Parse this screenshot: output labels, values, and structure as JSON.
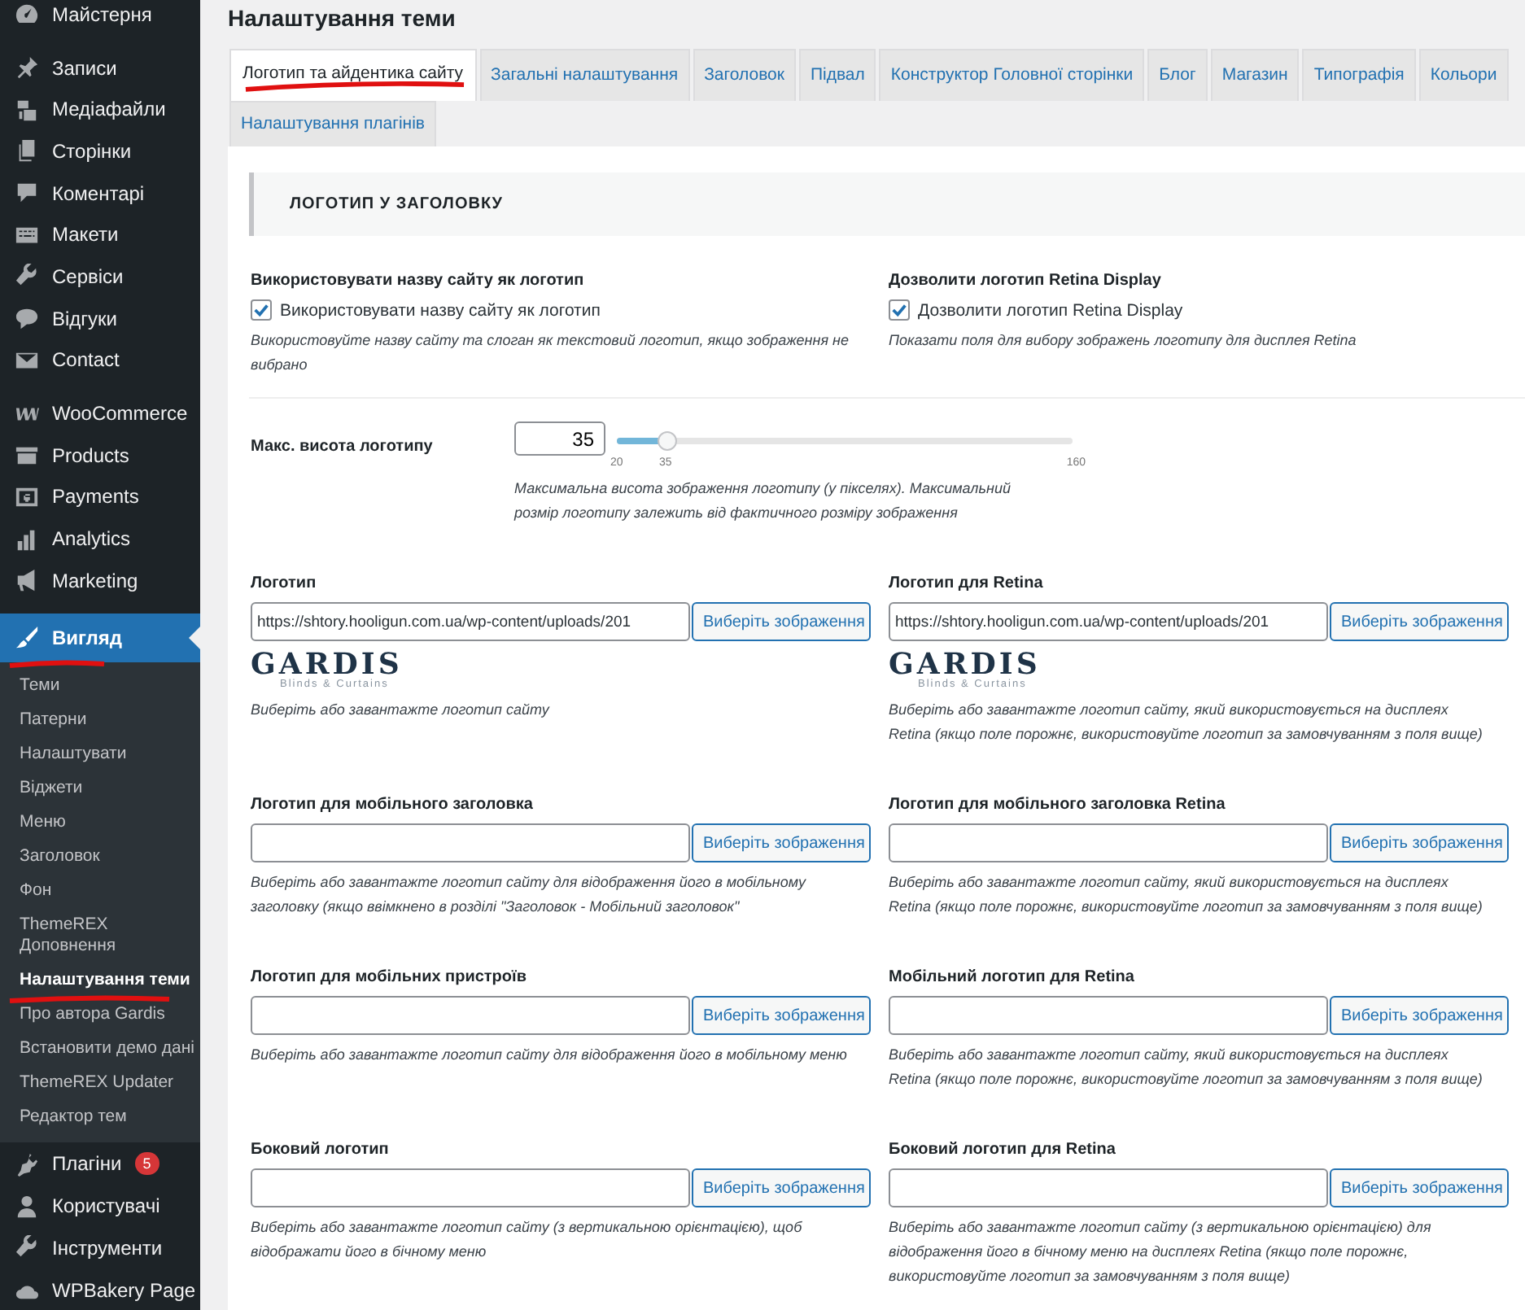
{
  "sidebar": {
    "groups": [
      {
        "items": [
          {
            "label": "Майстерня",
            "selected": false
          }
        ]
      },
      {
        "items": [
          {
            "label": "Записи",
            "selected": false
          },
          {
            "label": "Медіафайли",
            "selected": false
          },
          {
            "label": "Сторінки",
            "selected": false
          },
          {
            "label": "Коментарі",
            "selected": false
          },
          {
            "label": "Макети",
            "selected": false
          },
          {
            "label": "Сервіси",
            "selected": false
          },
          {
            "label": "Відгуки",
            "selected": false
          },
          {
            "label": "Contact",
            "selected": false
          }
        ]
      },
      {
        "items": [
          {
            "label": "WooCommerce",
            "selected": false
          },
          {
            "label": "Products",
            "selected": false
          },
          {
            "label": "Payments",
            "selected": false
          },
          {
            "label": "Analytics",
            "selected": false
          },
          {
            "label": "Marketing",
            "selected": false
          }
        ]
      },
      {
        "items": [
          {
            "label": "Вигляд",
            "selected": true,
            "expanded": true,
            "children": [
              {
                "label": "Теми",
                "selected": false
              },
              {
                "label": "Патерни",
                "selected": false
              },
              {
                "label": "Налаштувати",
                "selected": false
              },
              {
                "label": "Віджети",
                "selected": false
              },
              {
                "label": "Меню",
                "selected": false
              },
              {
                "label": "Заголовок",
                "selected": false
              },
              {
                "label": "Фон",
                "selected": false
              },
              {
                "label": "ThemeREX Доповнення",
                "selected": false
              },
              {
                "label": "Налаштування теми",
                "selected": true
              },
              {
                "label": "Про автора Gardis",
                "selected": false
              },
              {
                "label": "Встановити демо дані",
                "selected": false
              },
              {
                "label": "ThemeREX Updater",
                "selected": false
              },
              {
                "label": "Редактор тем",
                "selected": false
              }
            ]
          },
          {
            "label": "Плагіни",
            "selected": false,
            "badge": "5"
          },
          {
            "label": "Користувачі",
            "selected": false
          },
          {
            "label": "Інструменти",
            "selected": false
          },
          {
            "label": "WPBakery Page",
            "selected": false
          }
        ]
      }
    ]
  },
  "page_title": "Налаштування теми",
  "tabs": [
    {
      "label": "Логотип та айдентика сайту",
      "selected": true
    },
    {
      "label": "Загальні налаштування",
      "selected": false
    },
    {
      "label": "Заголовок",
      "selected": false
    },
    {
      "label": "Підвал",
      "selected": false
    },
    {
      "label": "Конструктор Головної сторінки",
      "selected": false
    },
    {
      "label": "Блог",
      "selected": false
    },
    {
      "label": "Магазин",
      "selected": false
    },
    {
      "label": "Типографія",
      "selected": false
    },
    {
      "label": "Кольори",
      "selected": false
    },
    {
      "label": "Налаштування плагінів",
      "selected": false
    }
  ],
  "section_heading": "ЛОГОТИП У ЗАГОЛОВКУ",
  "rows": [
    {
      "kind": "pair",
      "fields": [
        {
          "kind": "checkbox",
          "title": "Використовувати назву сайту як логотип",
          "checkbox_label": "Використовувати назву сайту як логотип",
          "checked": true,
          "description": "Використовуйте назву сайту та слоган як текстовий логотип, якщо зображення не вибрано"
        },
        {
          "kind": "checkbox",
          "title": "Дозволити логотип Retina Display",
          "checkbox_label": "Дозволити логотип Retina Display",
          "checked": true,
          "description": "Показати поля для вибору зображень логотипу для дисплея Retina"
        }
      ]
    },
    {
      "kind": "divider"
    },
    {
      "kind": "slider",
      "title": "Макс. висота логотипу",
      "value": "35",
      "level": 0.107,
      "min_label": "20",
      "thumb_label": "35",
      "max_label": "160",
      "description": "Максимальна висота зображення логотипу (у пікселях). Максимальний розмір логотипу залежить від фактичного розміру зображення"
    },
    {
      "kind": "pair",
      "fields": [
        {
          "kind": "image",
          "title": "Логотип",
          "value": "https://shtory.hooligun.com.ua/wp-content/uploads/201",
          "button": "Виберіть зображення",
          "preview": {
            "name": "GARDIS",
            "tagline": "Blinds & Curtains"
          },
          "description": "Виберіть або завантажте логотип сайту"
        },
        {
          "kind": "image",
          "title": "Логотип для Retina",
          "value": "https://shtory.hooligun.com.ua/wp-content/uploads/201",
          "button": "Виберіть зображення",
          "preview": {
            "name": "GARDIS",
            "tagline": "Blinds & Curtains"
          },
          "description": "Виберіть або завантажте логотип сайту, який використовується на дисплеях Retina (якщо поле порожнє, використовуйте логотип за замовчуванням з поля вище)"
        }
      ]
    },
    {
      "kind": "pair",
      "fields": [
        {
          "kind": "image",
          "title": "Логотип для мобільного заголовка",
          "button": "Виберіть зображення",
          "description": "Виберіть або завантажте логотип сайту для відображення його в мобільному заголовку (якщо ввімкнено в розділі \"Заголовок - Мобільний заголовок\""
        },
        {
          "kind": "image",
          "title": "Логотип для мобільного заголовка Retina",
          "button": "Виберіть зображення",
          "description": "Виберіть або завантажте логотип сайту, який використовується на дисплеях Retina (якщо поле порожнє, використовуйте логотип за замовчуванням з поля вище)"
        }
      ]
    },
    {
      "kind": "pair",
      "fields": [
        {
          "kind": "image",
          "title": "Логотип для мобільних пристроїв",
          "button": "Виберіть зображення",
          "description": "Виберіть або завантажте логотип сайту для відображення його в мобільному меню"
        },
        {
          "kind": "image",
          "title": "Мобільний логотип для Retina",
          "button": "Виберіть зображення",
          "description": "Виберіть або завантажте логотип сайту, який використовується на дисплеях Retina (якщо поле порожнє, використовуйте логотип за замовчуванням з поля вище)"
        }
      ]
    },
    {
      "kind": "pair",
      "fields": [
        {
          "kind": "image",
          "title": "Боковий логотип",
          "button": "Виберіть зображення",
          "description": "Виберіть або завантажте логотип сайту (з вертикальною орієнтацією), щоб відображати його в бічному меню"
        },
        {
          "kind": "image",
          "title": "Боковий логотип для Retina",
          "button": "Виберіть зображення",
          "description": "Виберіть або завантажте логотип сайту (з вертикальною орієнтацією) для відображення його в бічному меню на дисплеях Retina (якщо поле порожнє, використовуйте логотип за замовчуванням з поля вище)"
        }
      ]
    }
  ]
}
